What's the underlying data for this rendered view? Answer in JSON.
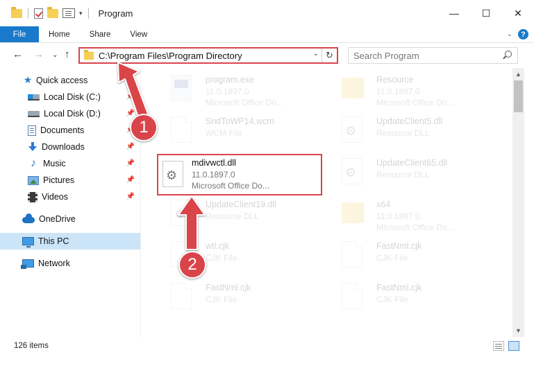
{
  "window": {
    "title": "Program",
    "controls": {
      "minimize": "—",
      "maximize": "☐",
      "close": "✕"
    }
  },
  "ribbon": {
    "tabs": [
      "File",
      "Home",
      "Share",
      "View"
    ],
    "help": "?",
    "expand": "⌄"
  },
  "nav": {
    "back": "←",
    "forward": "→",
    "recent": "⌄",
    "up": "↑",
    "address": "C:\\Program Files\\Program Directory",
    "address_dropdown": "⌄",
    "refresh": "↻",
    "search_placeholder": "Search Program"
  },
  "sidebar": {
    "items": [
      {
        "label": "Quick access",
        "icon": "star-icon",
        "pinned": false
      },
      {
        "label": "Local Disk (C:)",
        "icon": "disk-icon",
        "pinned": true
      },
      {
        "label": "Local Disk (D:)",
        "icon": "disk-icon",
        "pinned": true
      },
      {
        "label": "Documents",
        "icon": "documents-icon",
        "pinned": true
      },
      {
        "label": "Downloads",
        "icon": "downloads-icon",
        "pinned": true
      },
      {
        "label": "Music",
        "icon": "music-icon",
        "pinned": true
      },
      {
        "label": "Pictures",
        "icon": "pictures-icon",
        "pinned": true
      },
      {
        "label": "Videos",
        "icon": "videos-icon",
        "pinned": true
      },
      {
        "label": "OneDrive",
        "icon": "onedrive-icon",
        "pinned": false
      },
      {
        "label": "This PC",
        "icon": "this-pc-icon",
        "pinned": false,
        "selected": true
      },
      {
        "label": "Network",
        "icon": "network-icon",
        "pinned": false
      }
    ],
    "pin_glyph": "📌"
  },
  "files": [
    {
      "name": "program.exe",
      "line1": "11.0.1897.0",
      "line2": "Microsoft Office Do...",
      "type": "exe"
    },
    {
      "name": "Resource",
      "line1": "11.0.1897.0",
      "line2": "Microsoft Office Do...",
      "type": "folder"
    },
    {
      "name": "SndToWP14.wcm",
      "line1": "WCM File",
      "line2": "",
      "type": "doc"
    },
    {
      "name": "UpdateClient5.dll",
      "line1": "Resource DLL",
      "line2": "",
      "type": "dll"
    },
    {
      "name": "mdivwctl.dll",
      "line1": "11.0.1897.0",
      "line2": "Microsoft Office Do...",
      "type": "dll",
      "highlighted": true
    },
    {
      "name": "UpdateClient65.dll",
      "line1": "Resource DLL",
      "line2": "",
      "type": "dll"
    },
    {
      "name": "UpdateClient19.dll",
      "line1": "Resource DLL",
      "line2": "",
      "type": "dll"
    },
    {
      "name": "x64",
      "line1": "11.0.1897.0",
      "line2": "Microsoft Office Do...",
      "type": "folder"
    },
    {
      "name": "wtl.cjk",
      "line1": "CJK File",
      "line2": "",
      "type": "doc"
    },
    {
      "name": "FastNml.cjk",
      "line1": "CJK File",
      "line2": "",
      "type": "doc"
    },
    {
      "name": "FastNml.cjk",
      "line1": "CJK File",
      "line2": "",
      "type": "doc"
    },
    {
      "name": "FastNml.cjk",
      "line1": "CJK File",
      "line2": "",
      "type": "doc"
    }
  ],
  "status": {
    "item_count": "126 items"
  },
  "annotations": {
    "step1": "1",
    "step2": "2",
    "color": "#d9444a"
  },
  "colors": {
    "accent": "#1979ca",
    "highlight": "#d9444a",
    "selection": "#cce4f7"
  }
}
